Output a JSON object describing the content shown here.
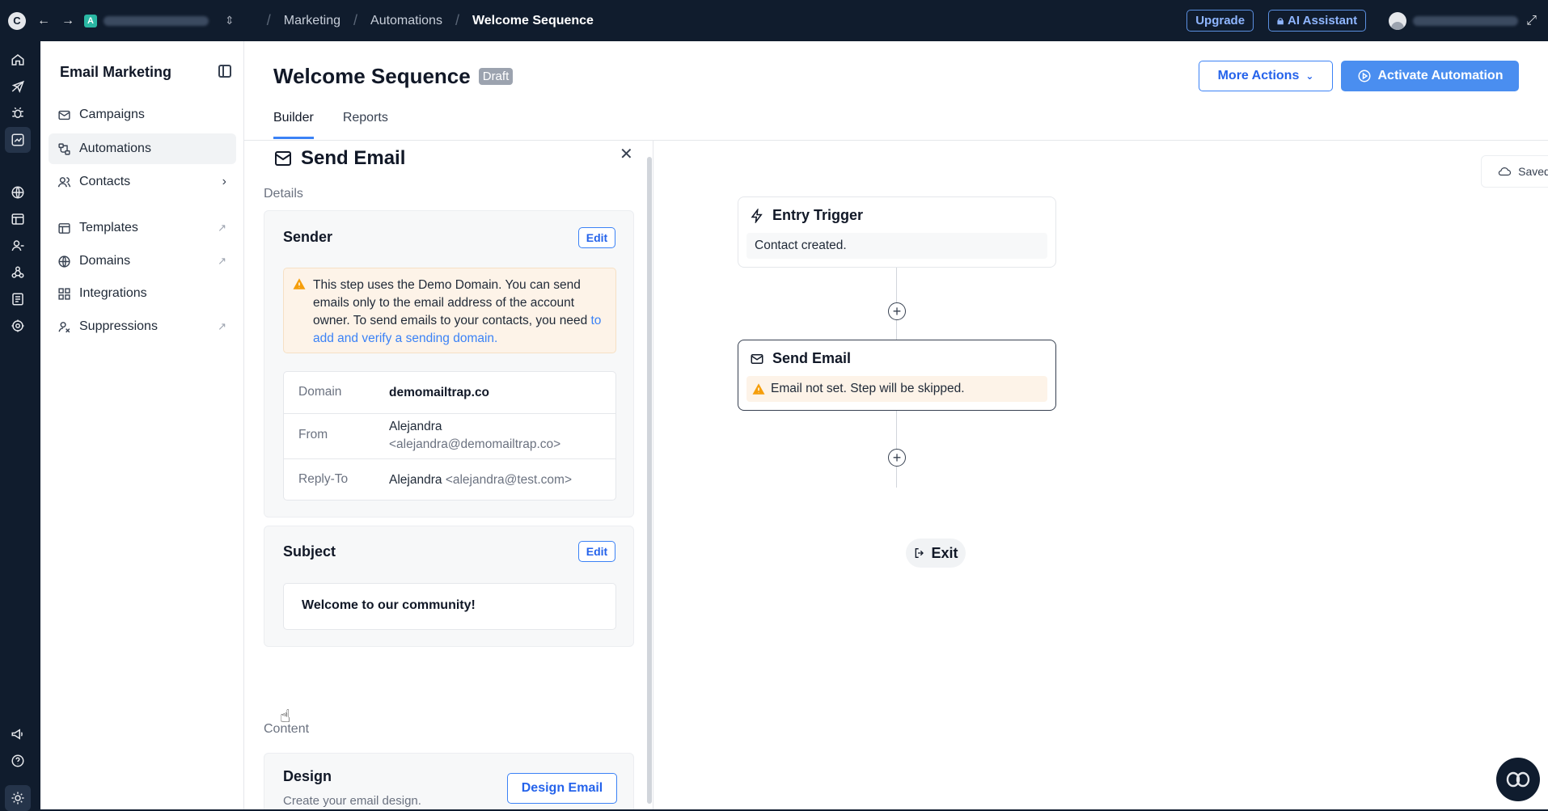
{
  "topbar": {
    "logo": "C",
    "account_initial": "A",
    "breadcrumbs": [
      "Marketing",
      "Automations",
      "Welcome Sequence"
    ],
    "upgrade_label": "Upgrade",
    "ai_label": "AI Assistant"
  },
  "sidebar": {
    "title": "Email Marketing",
    "items": [
      {
        "label": "Campaigns",
        "icon": "mail-icon"
      },
      {
        "label": "Automations",
        "icon": "automation-icon",
        "active": true
      },
      {
        "label": "Contacts",
        "icon": "users-icon",
        "tail": "chevron"
      },
      {
        "label": "Templates",
        "icon": "template-icon",
        "tail": "external"
      },
      {
        "label": "Domains",
        "icon": "globe-icon",
        "tail": "external"
      },
      {
        "label": "Integrations",
        "icon": "grid-icon"
      },
      {
        "label": "Suppressions",
        "icon": "user-block-icon",
        "tail": "external"
      }
    ]
  },
  "header": {
    "title": "Welcome Sequence",
    "badge": "Draft",
    "more_actions": "More Actions",
    "activate": "Activate Automation",
    "tabs": [
      {
        "label": "Builder",
        "active": true
      },
      {
        "label": "Reports"
      }
    ]
  },
  "panel": {
    "title": "Send Email",
    "details_label": "Details",
    "sender": {
      "title": "Sender",
      "edit": "Edit",
      "warning_text": "This step uses the Demo Domain. You can send emails only to the email address of the account owner. To send emails to your contacts, you need ",
      "warning_link": "to add and verify a sending domain.",
      "rows": {
        "domain_key": "Domain",
        "domain_value": "demomailtrap.co",
        "from_key": "From",
        "from_name": "Alejandra",
        "from_email": "<alejandra@demomailtrap.co>",
        "reply_key": "Reply-To",
        "reply_name": "Alejandra",
        "reply_email": "<alejandra@test.com>"
      }
    },
    "subject": {
      "title": "Subject",
      "edit": "Edit",
      "value": "Welcome to our community!"
    },
    "content_label": "Content",
    "design": {
      "title": "Design",
      "desc": "Create your email design.",
      "button": "Design Email"
    }
  },
  "canvas": {
    "saved": "Saved",
    "trigger": {
      "title": "Entry Trigger",
      "body": "Contact created."
    },
    "email": {
      "title": "Send Email",
      "body": "Email not set. Step will be skipped."
    },
    "exit": "Exit",
    "zoom_in": "+"
  },
  "colors": {
    "primary": "#3b82f6",
    "topbar": "#101c2d",
    "warning_bg": "#fdf3e8",
    "warning_icon": "#f59e0b"
  }
}
